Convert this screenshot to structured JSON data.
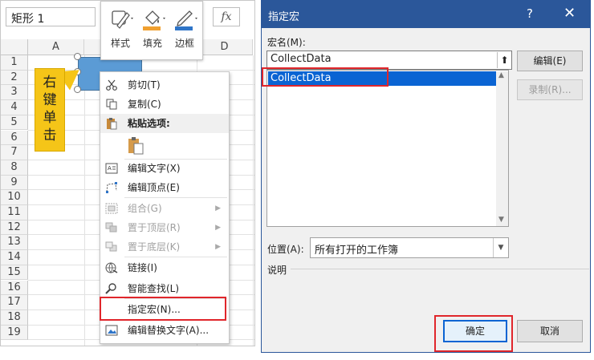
{
  "excel": {
    "name_box": "矩形 1",
    "fx": "fx",
    "columns": [
      "A",
      "D"
    ],
    "rows": [
      "1",
      "2",
      "3",
      "4",
      "5",
      "6",
      "7",
      "8",
      "9",
      "10",
      "11",
      "12",
      "13",
      "14",
      "15",
      "16",
      "17",
      "18",
      "19"
    ],
    "callout": [
      "右",
      "键",
      "单",
      "击"
    ],
    "mini_toolbar": [
      {
        "label": "样式",
        "icon": "shape-style-icon"
      },
      {
        "label": "填充",
        "icon": "fill-bucket-icon"
      },
      {
        "label": "边框",
        "icon": "outline-pen-icon"
      }
    ],
    "context_menu": {
      "cut": "剪切(T)",
      "copy": "复制(C)",
      "paste_options": "粘贴选项:",
      "edit_text": "编辑文字(X)",
      "edit_points": "编辑顶点(E)",
      "group": "组合(G)",
      "bring_front": "置于顶层(R)",
      "send_back": "置于底层(K)",
      "link": "链接(I)",
      "smart_lookup": "智能查找(L)",
      "assign_macro": "指定宏(N)...",
      "edit_alt_text": "编辑替换文字(A)..."
    },
    "colors": {
      "shape": "#5b9bd5",
      "callout": "#f5c518",
      "highlight": "#e0262b"
    }
  },
  "dialog": {
    "title": "指定宏",
    "help": "?",
    "close": "✕",
    "macro_name_label": "宏名(M):",
    "macro_name_value": "CollectData",
    "macro_list": [
      "CollectData"
    ],
    "edit_button": "编辑(E)",
    "record_button": "录制(R)...",
    "location_label": "位置(A):",
    "location_value": "所有打开的工作簿",
    "description_label": "说明",
    "ok_button": "确定",
    "cancel_button": "取消",
    "colors": {
      "title_bar": "#2b579a",
      "selection": "#0a64d3"
    }
  }
}
